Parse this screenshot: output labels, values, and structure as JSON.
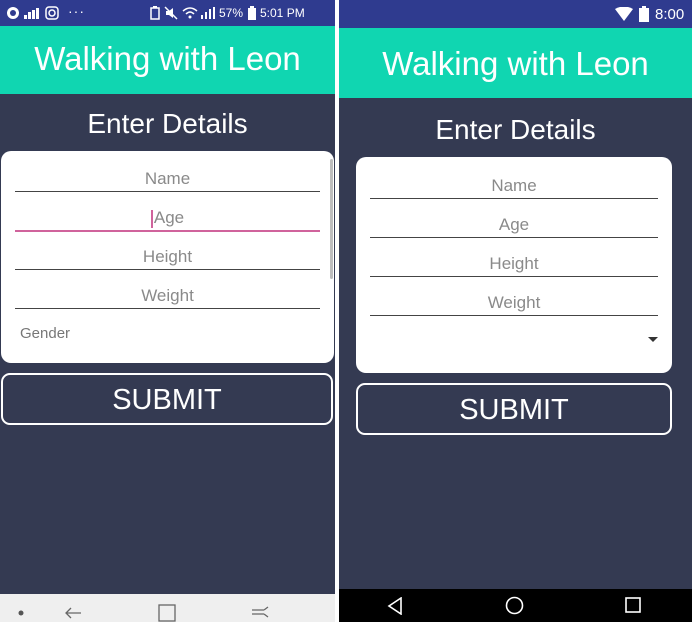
{
  "left": {
    "status": {
      "battery": "57%",
      "time": "5:01 PM",
      "dots": "···"
    },
    "app_title": "Walking with Leon",
    "heading": "Enter Details",
    "fields": {
      "name": "Name",
      "age": "Age",
      "height": "Height",
      "weight": "Weight"
    },
    "gender_label": "Gender",
    "submit": "SUBMIT"
  },
  "right": {
    "status": {
      "time": "8:00"
    },
    "app_title": "Walking with Leon",
    "heading": "Enter Details",
    "fields": {
      "name": "Name",
      "age": "Age",
      "height": "Height",
      "weight": "Weight"
    },
    "submit": "SUBMIT"
  },
  "colors": {
    "status_bar": "#2f3b8f",
    "app_bar": "#10d6b1",
    "background": "#343a52",
    "focus_accent": "#d0639c"
  },
  "icons": [
    "snapchat-icon",
    "signal-icon",
    "instagram-icon",
    "battery-saver-icon",
    "mute-icon",
    "wifi-icon",
    "battery-icon",
    "back-icon",
    "home-icon",
    "recents-icon",
    "dropdown-arrow-icon"
  ]
}
